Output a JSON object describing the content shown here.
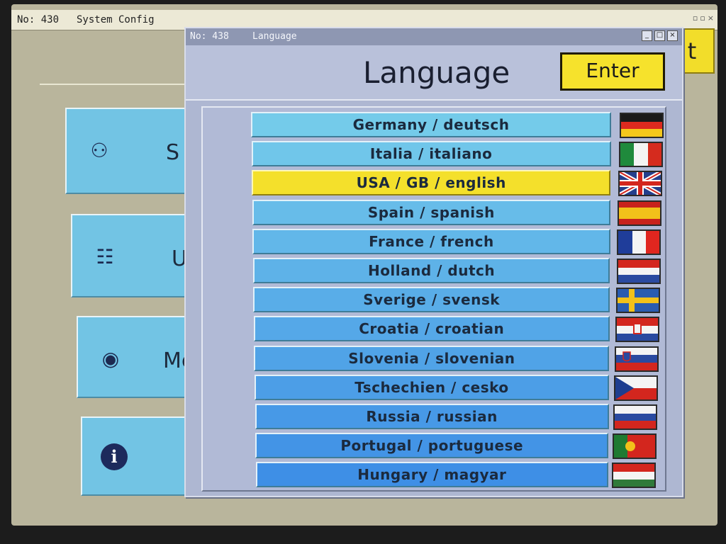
{
  "background_window": {
    "number": "No: 430",
    "title": "System Config",
    "ok_partial": "t",
    "tiles": [
      {
        "icon": "binoculars-icon",
        "glyph": "⚇",
        "label": "S"
      },
      {
        "icon": "network-icon",
        "glyph": "☷",
        "label": "U"
      },
      {
        "icon": "eye-icon",
        "glyph": "◉",
        "label": "Mes"
      },
      {
        "icon": "info-icon",
        "glyph": "i",
        "label": ""
      }
    ]
  },
  "dialog": {
    "number": "No: 438",
    "title": "Language",
    "heading": "Language",
    "enter_label": "Enter",
    "window_controls": [
      "_",
      "□",
      "×"
    ]
  },
  "languages": [
    {
      "label": "Germany / deutsch",
      "flag": "germany-flag-icon",
      "selected": false
    },
    {
      "label": "Italia / italiano",
      "flag": "italy-flag-icon",
      "selected": false
    },
    {
      "label": "USA / GB / english",
      "flag": "uk-flag-icon",
      "selected": true
    },
    {
      "label": "Spain / spanish",
      "flag": "spain-flag-icon",
      "selected": false
    },
    {
      "label": "France / french",
      "flag": "france-flag-icon",
      "selected": false
    },
    {
      "label": "Holland / dutch",
      "flag": "netherlands-flag-icon",
      "selected": false
    },
    {
      "label": "Sverige / svensk",
      "flag": "sweden-flag-icon",
      "selected": false
    },
    {
      "label": "Croatia / croatian",
      "flag": "croatia-flag-icon",
      "selected": false
    },
    {
      "label": "Slovenia / slovenian",
      "flag": "slovenia-flag-icon",
      "selected": false
    },
    {
      "label": "Tschechien / cesko",
      "flag": "czech-flag-icon",
      "selected": false
    },
    {
      "label": "Russia / russian",
      "flag": "russia-flag-icon",
      "selected": false
    },
    {
      "label": "Portugal / portuguese",
      "flag": "portugal-flag-icon",
      "selected": false
    },
    {
      "label": "Hungary / magyar",
      "flag": "hungary-flag-icon",
      "selected": false
    }
  ],
  "colors": {
    "row_top": "#74cbea",
    "row_bottom": "#3e8fe6",
    "selected": "#f4e02b",
    "enter": "#f6e22c"
  }
}
